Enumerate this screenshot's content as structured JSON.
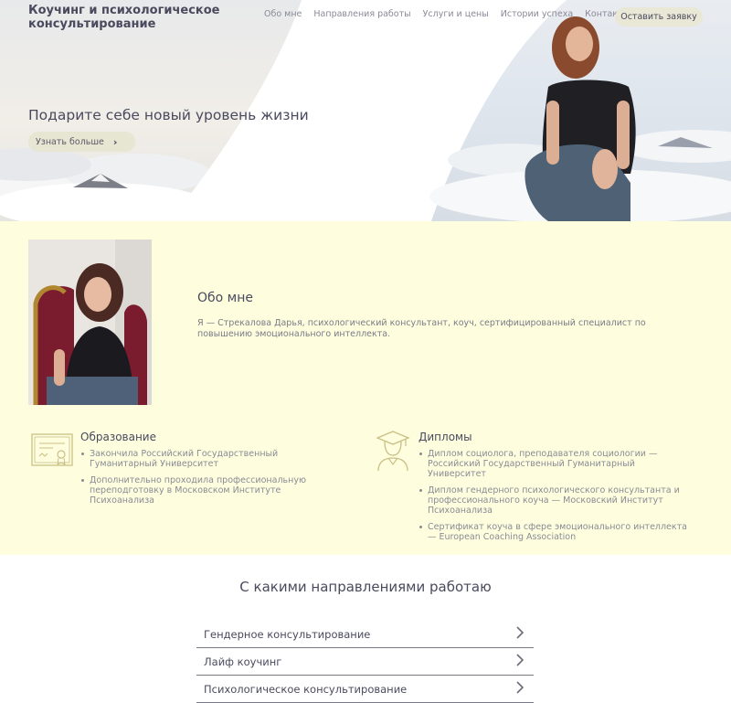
{
  "header": {
    "brand_line1": "Коучинг и психологическое",
    "brand_line2": "консультирование",
    "nav": [
      "Обо мне",
      "Направления работы",
      "Услуги и цены",
      "Истории успеха",
      "Контакты"
    ],
    "cta": "Оставить заявку"
  },
  "hero": {
    "title": "Подарите себе новый уровень жизни",
    "button": "Узнать больше"
  },
  "about": {
    "title": "Обо мне",
    "text": "Я — Стрекалова Дарья, психологический консультант, коуч, сертифицированный специалист по повышению эмоционального интеллекта."
  },
  "education": {
    "title": "Образование",
    "items": [
      "Закончила Российский Государственный Гуманитарный Университет",
      "Дополнительно проходила профессиональную переподготовку в Московском Институте Психоанализа"
    ]
  },
  "diplomas": {
    "title": "Дипломы",
    "items": [
      "Диплом социолога, преподавателя социологии — Российский Государственный Гуманитарный Университет",
      "Диплом гендерного психологического консультанта и профессионального коуча — Московский Институт Психоанализа",
      "Сертификат коуча в сфере эмоционального интеллекта — European Coaching Association"
    ]
  },
  "directions": {
    "title": "С какими направлениями работаю",
    "items": [
      "Гендерное консультирование",
      "Лайф коучинг",
      "Психологическое консультирование"
    ]
  },
  "colors": {
    "accent_bg": "#fefedf",
    "button_bg": "#e9e8d6",
    "text": "#4a4a5e"
  }
}
